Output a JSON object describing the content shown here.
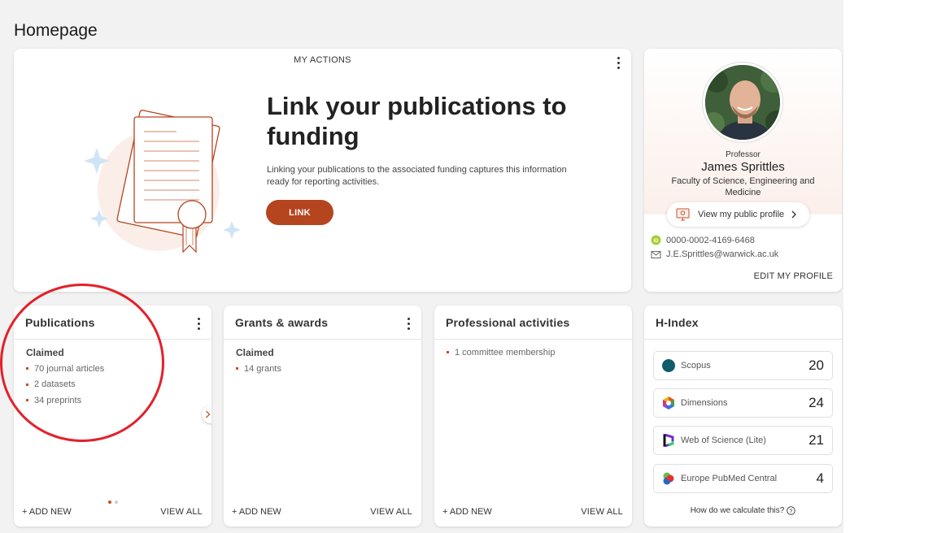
{
  "page": {
    "title": "Homepage"
  },
  "actions": {
    "label": "MY ACTIONS",
    "headline": "Link your publications to funding",
    "description": "Linking your publications to the associated funding captures this information ready for reporting activities.",
    "button": "LINK"
  },
  "profile": {
    "title": "Professor",
    "name": "James Sprittles",
    "department": "Faculty of Science, Engineering and Medicine",
    "public_profile": "View my public profile",
    "orcid": "0000-0002-4169-6468",
    "email": "J.E.Sprittles@warwick.ac.uk",
    "edit": "EDIT MY PROFILE"
  },
  "publications": {
    "title": "Publications",
    "subhead": "Claimed",
    "items": [
      "70 journal articles",
      "2 datasets",
      "34 preprints"
    ],
    "add_new": "+ ADD NEW",
    "view_all": "VIEW ALL"
  },
  "grants": {
    "title": "Grants & awards",
    "subhead": "Claimed",
    "items": [
      "14 grants"
    ],
    "add_new": "+ ADD NEW",
    "view_all": "VIEW ALL"
  },
  "professional": {
    "title": "Professional activities",
    "items": [
      "1 committee membership"
    ],
    "add_new": "+ ADD NEW",
    "view_all": "VIEW ALL"
  },
  "hindex": {
    "title": "H-Index",
    "rows": [
      {
        "source": "Scopus",
        "value": "20",
        "icon": "scopus-icon"
      },
      {
        "source": "Dimensions",
        "value": "24",
        "icon": "dimensions-icon"
      },
      {
        "source": "Web of Science (Lite)",
        "value": "21",
        "icon": "web-of-science-icon"
      },
      {
        "source": "Europe PubMed Central",
        "value": "4",
        "icon": "europe-pmc-icon"
      }
    ],
    "help": "How do we calculate this?"
  },
  "colors": {
    "accent": "#b5451f",
    "annotation": "#e3212b"
  }
}
